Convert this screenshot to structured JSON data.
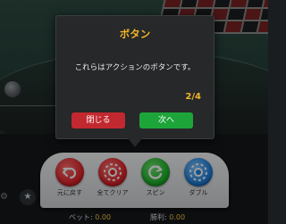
{
  "dialog": {
    "title": "ボタン",
    "message": "これらはアクションのボタンです。",
    "counter": "2/4",
    "close_label": "閉じる",
    "next_label": "次へ"
  },
  "actions": [
    {
      "label": "元に戻す",
      "icon": "undo-icon",
      "color": "#e3262c"
    },
    {
      "label": "全てクリア",
      "icon": "clear-chip-icon",
      "color": "#e3262c"
    },
    {
      "label": "スピン",
      "icon": "spin-icon",
      "color": "#1fb52b"
    },
    {
      "label": "ダブル",
      "icon": "double-chip-icon",
      "color": "#1f82e0"
    }
  ],
  "status": {
    "bet_label": "ベット:",
    "bet_value": "0.00",
    "win_label": "勝利:",
    "win_value": "0.00"
  },
  "colors": {
    "accent": "#f1b42a",
    "close_button": "#c2282f",
    "next_button": "#1ea53a"
  }
}
